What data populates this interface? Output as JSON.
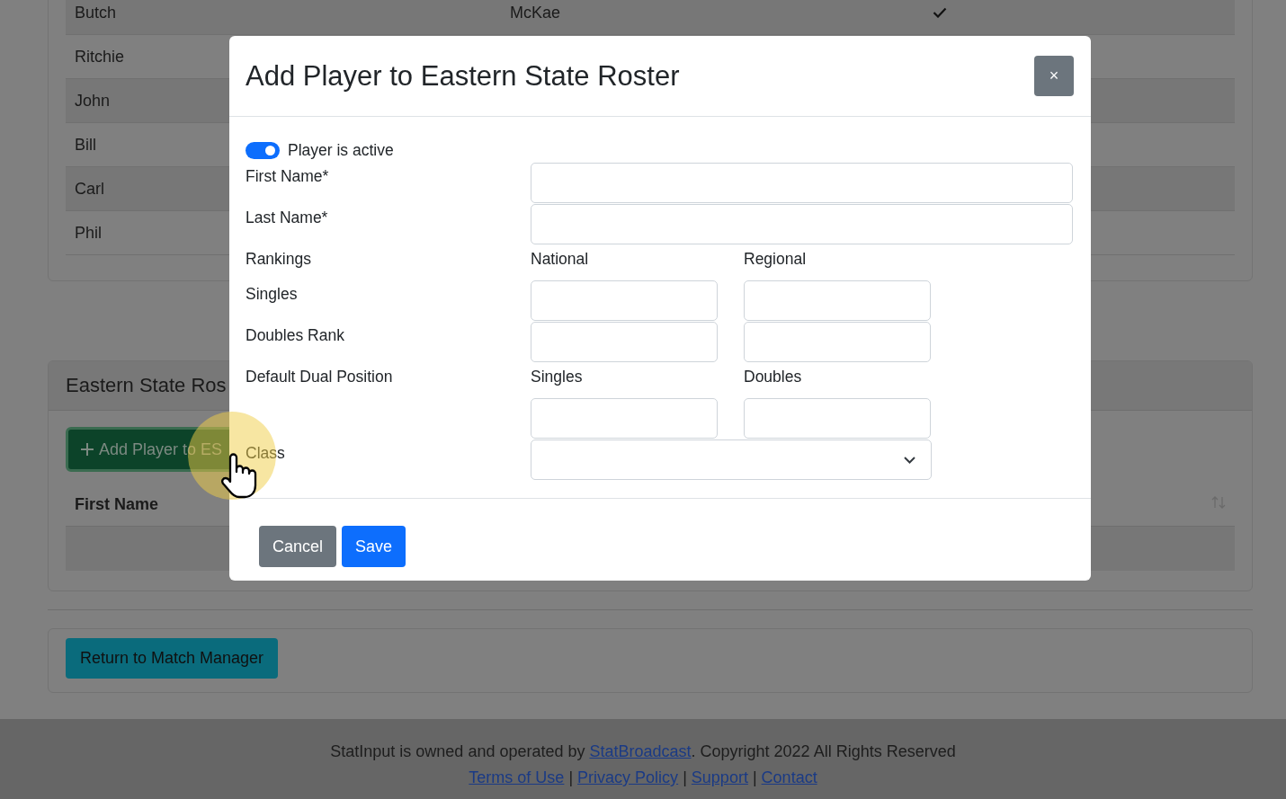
{
  "top_row": {
    "first_name": "Butch",
    "last_name": "McKae",
    "checked": true
  },
  "rows": [
    "Ritchie",
    "John",
    "Bill",
    "Carl",
    "Phil"
  ],
  "roster_card": {
    "title": "Eastern State Ros",
    "add_button": "Add Player to ES",
    "column": "First Name"
  },
  "return_button": "Return to Match Manager",
  "footer": {
    "before": "StatInput is owned and operated by ",
    "link": "StatBroadcast",
    "after": ". Copyright 2022 All Rights Reserved",
    "links": [
      "Terms of Use",
      "Privacy Policy",
      "Support",
      "Contact"
    ],
    "separators": [
      "|",
      "|",
      "|"
    ]
  },
  "modal": {
    "title": "Add Player to Eastern State Roster",
    "close": "×",
    "toggle": {
      "label": "Player is active",
      "on": true
    },
    "rows": [
      {
        "kind": "text",
        "label": "First Name*"
      },
      {
        "kind": "text",
        "label": "Last Name*"
      },
      {
        "kind": "heading",
        "label": "Rankings",
        "col_2": "National",
        "col_3": "Regional"
      },
      {
        "kind": "pair",
        "label": "Singles"
      },
      {
        "kind": "pair",
        "label": "Doubles Rank"
      },
      {
        "kind": "heading",
        "label": "Default Dual Position",
        "col_2": "Singles",
        "col_3": "Doubles"
      },
      {
        "kind": "pair"
      },
      {
        "kind": "select",
        "label": "Class"
      }
    ],
    "buttons": [
      {
        "label": "Cancel",
        "kind": "secondary"
      },
      {
        "label": "Save",
        "kind": "primary"
      }
    ]
  }
}
